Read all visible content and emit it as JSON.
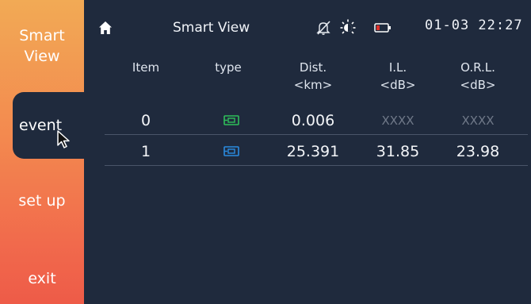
{
  "sidebar": {
    "items": [
      {
        "label_line1": "Smart",
        "label_line2": "View"
      },
      {
        "label": "event"
      },
      {
        "label": "set up"
      },
      {
        "label": "exit"
      }
    ]
  },
  "status_bar": {
    "title": "Smart View",
    "datetime": "01-03 22:27",
    "icons": [
      "home-icon",
      "mute-icon",
      "brightness-icon",
      "battery-icon"
    ]
  },
  "table": {
    "columns": [
      {
        "line1": "Item",
        "line2": ""
      },
      {
        "line1": "type",
        "line2": ""
      },
      {
        "line1": "Dist.",
        "line2": "<km>"
      },
      {
        "line1": "I.L.",
        "line2": "<dB>"
      },
      {
        "line1": "O.R.L.",
        "line2": "<dB>"
      }
    ],
    "rows": [
      {
        "item": "0",
        "type_icon": "connector-green-icon",
        "dist": "0.006",
        "il": "XXXX",
        "orl": "XXXX"
      },
      {
        "item": "1",
        "type_icon": "connector-blue-icon",
        "dist": "25.391",
        "il": "31.85",
        "orl": "23.98"
      }
    ]
  },
  "colors": {
    "sidebar_gradient_top": "#f2aa55",
    "sidebar_gradient_bottom": "#ee5b48",
    "panel_bg": "#1f2a3d",
    "type_green": "#2fbf5a",
    "type_blue": "#2a8be0",
    "battery_red": "#e0302a"
  }
}
